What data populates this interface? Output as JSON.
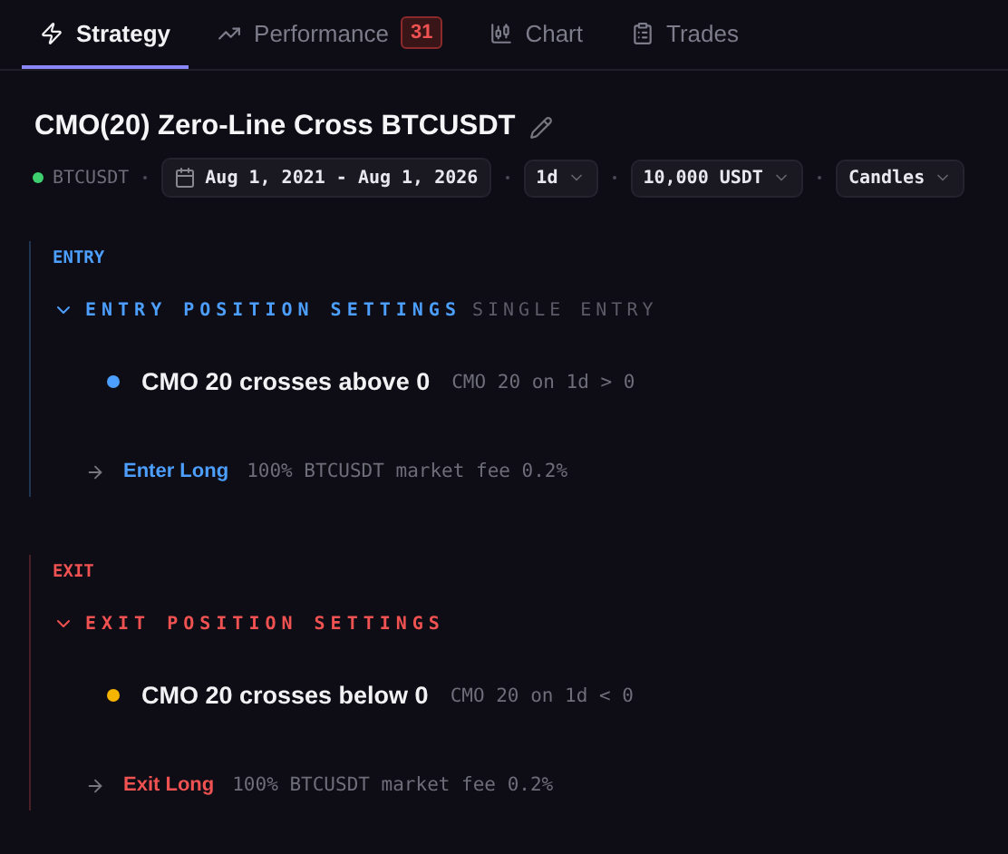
{
  "tabs": [
    {
      "label": "Strategy",
      "selected": true
    },
    {
      "label": "Performance",
      "selected": false,
      "badge": "31"
    },
    {
      "label": "Chart",
      "selected": false
    },
    {
      "label": "Trades",
      "selected": false
    }
  ],
  "title": "CMO(20) Zero-Line Cross BTCUSDT",
  "controls": {
    "symbol": "BTCUSDT",
    "date_range": "Aug 1, 2021 - Aug 1, 2026",
    "interval": "1d",
    "capital": "10,000 USDT",
    "view": "Candles"
  },
  "sections": [
    {
      "kind": "entry",
      "label": "ENTRY",
      "settings_title": "ENTRY POSITION SETTINGS",
      "settings_note": "SINGLE ENTRY",
      "expanded": true,
      "condition": {
        "text": "CMO 20 crosses above 0",
        "color": "#4d9fff",
        "expr": "CMO 20 on 1d > 0"
      },
      "action": {
        "label": "Enter Long",
        "detail": "100% BTCUSDT market fee 0.2%"
      }
    },
    {
      "kind": "exit",
      "label": "EXIT",
      "settings_title": "EXIT POSITION SETTINGS",
      "expanded": true,
      "condition": {
        "text": "CMO 20 crosses below 0",
        "color": "#f5b400",
        "expr": "CMO 20 on 1d < 0"
      },
      "action": {
        "label": "Exit Long",
        "detail": "100% BTCUSDT market fee 0.2%"
      }
    }
  ]
}
